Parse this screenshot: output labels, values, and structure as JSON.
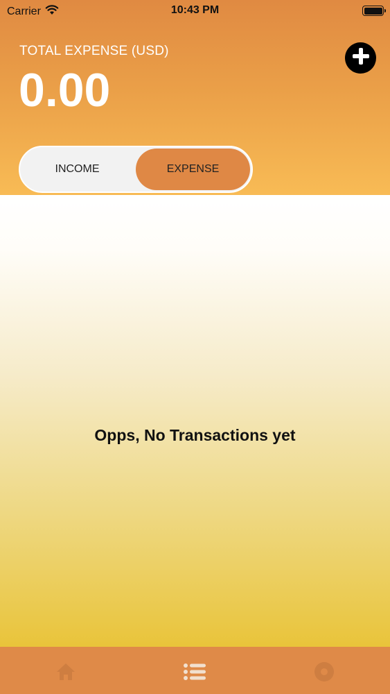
{
  "status_bar": {
    "carrier": "Carrier",
    "time": "10:43 PM",
    "wifi_icon": "wifi-icon",
    "battery_icon": "battery-icon"
  },
  "header": {
    "total_label": "TOTAL EXPENSE (USD)",
    "total_value": "0.00",
    "add_icon": "plus-circle-icon"
  },
  "toggle": {
    "income_label": "INCOME",
    "expense_label": "EXPENSE",
    "selected": "EXPENSE"
  },
  "main": {
    "empty_message": "Opps, No Transactions yet"
  },
  "tabbar": {
    "items": [
      {
        "icon": "home-icon"
      },
      {
        "icon": "list-icon"
      },
      {
        "icon": "settings-icon"
      }
    ]
  },
  "colors": {
    "header_top": "#e08a42",
    "header_bottom": "#f8bb55",
    "accent": "#df8845",
    "tabbar": "#df8a48",
    "content_bottom": "#e9c43a"
  }
}
